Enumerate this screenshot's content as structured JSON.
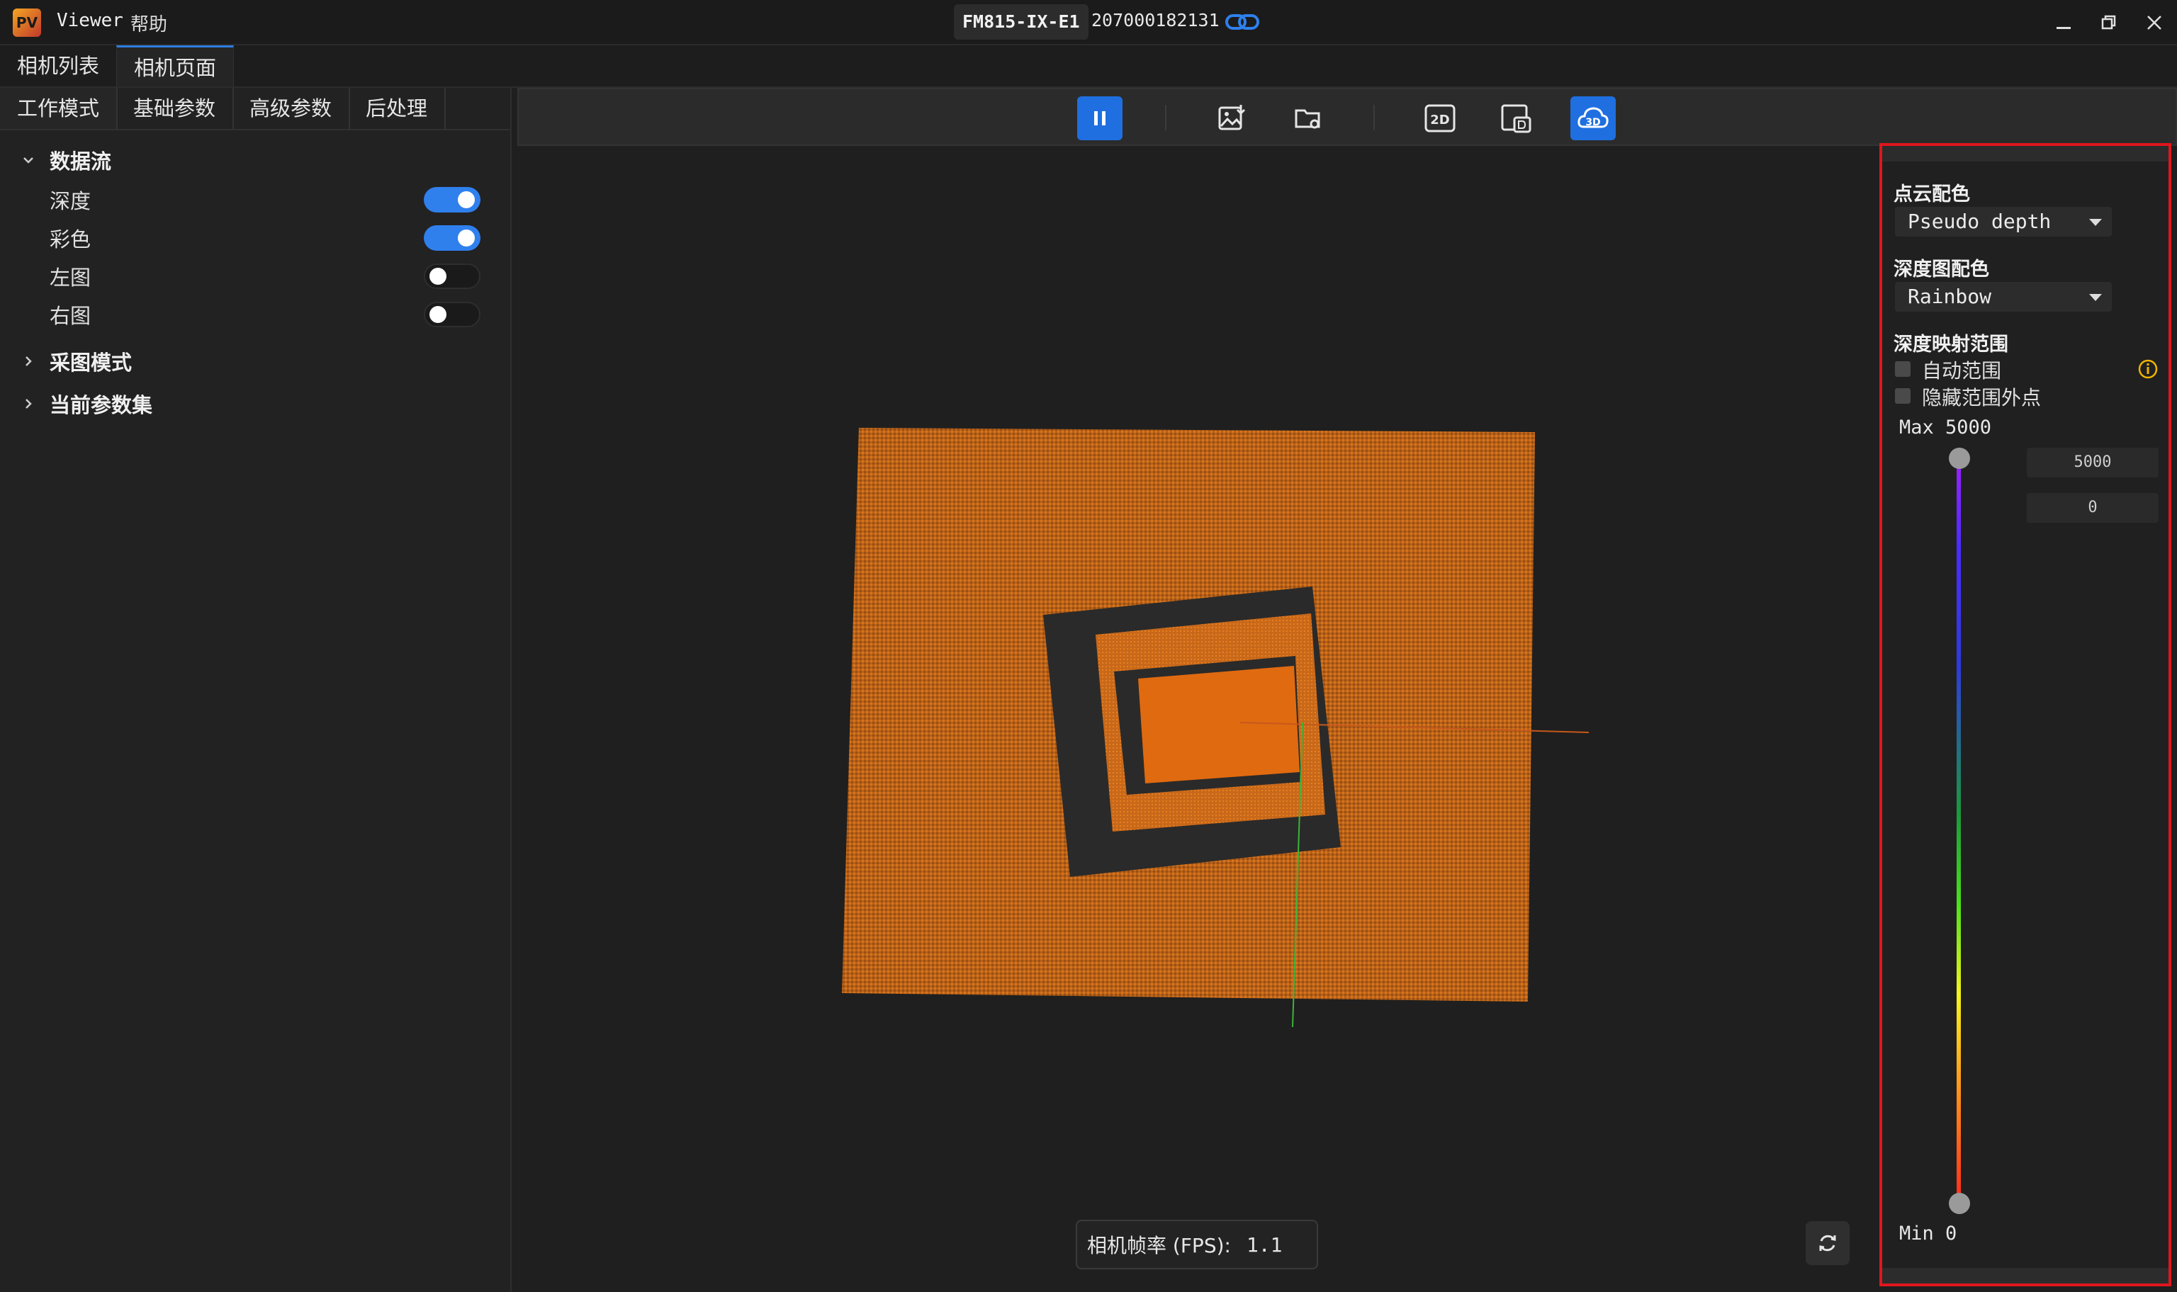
{
  "window": {
    "logo_text": "PV",
    "app_name": "Viewer",
    "menu_help": "帮助",
    "device_model": "FM815-IX-E1",
    "device_serial": "207000182131"
  },
  "top_tabs": [
    {
      "label": "相机列表"
    },
    {
      "label": "相机页面"
    }
  ],
  "sub_tabs": [
    {
      "label": "工作模式"
    },
    {
      "label": "基础参数"
    },
    {
      "label": "高级参数"
    },
    {
      "label": "后处理"
    }
  ],
  "tree": {
    "data_stream": {
      "label": "数据流",
      "streams": [
        {
          "label": "深度",
          "enabled": true
        },
        {
          "label": "彩色",
          "enabled": true
        },
        {
          "label": "左图",
          "enabled": false
        },
        {
          "label": "右图",
          "enabled": false
        }
      ]
    },
    "capture_mode": {
      "label": "采图模式"
    },
    "current_params": {
      "label": "当前参数集"
    }
  },
  "toolbar": {
    "icons": [
      "pause-icon",
      "save-image-icon",
      "open-folder-icon",
      "view-2d-icon",
      "view-depth-icon",
      "view-3d-icon"
    ],
    "active": [
      "pause-icon",
      "view-3d-icon"
    ],
    "view_2d_label": "2D",
    "view_3d_label": "3D"
  },
  "fps": {
    "label": "相机帧率 (FPS):",
    "value": "1.1"
  },
  "right_panel": {
    "point_cloud_color": {
      "heading": "点云配色",
      "value": "Pseudo depth"
    },
    "depth_color": {
      "heading": "深度图配色",
      "value": "Rainbow"
    },
    "depth_range": {
      "heading": "深度映射范围",
      "auto_range": {
        "label": "自动范围",
        "checked": false
      },
      "hide_outside": {
        "label": "隐藏范围外点",
        "checked": false
      },
      "max_label": "Max 5000",
      "min_label": "Min 0",
      "max_input": "5000",
      "min_input": "0"
    }
  },
  "colors": {
    "accent": "#2f80ed",
    "highlight_border": "#e0161d",
    "point_cloud": "#d9741a"
  }
}
